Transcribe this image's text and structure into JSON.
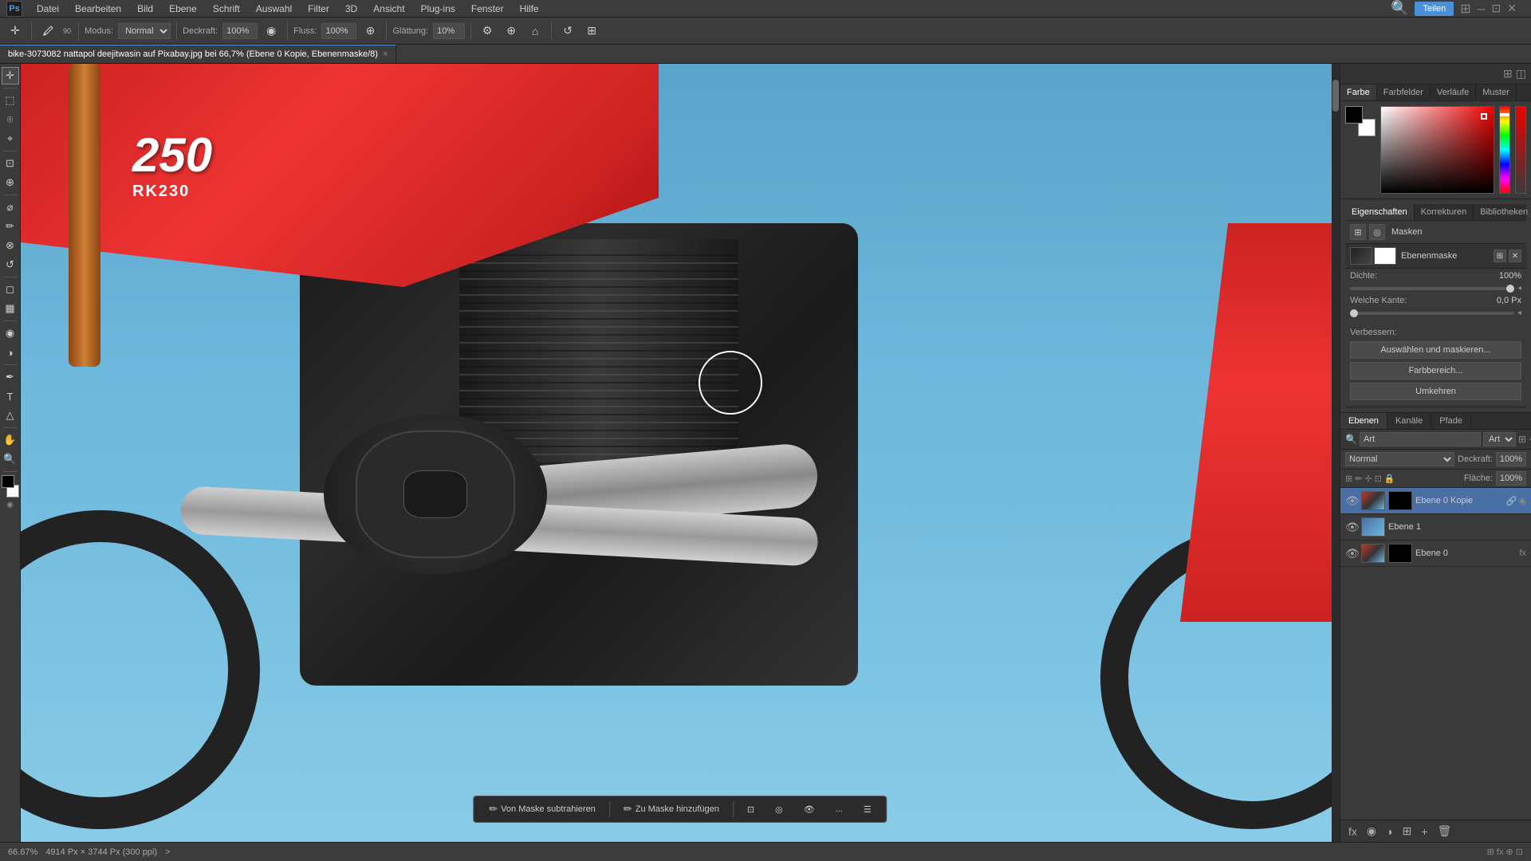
{
  "menubar": {
    "items": [
      "Datei",
      "Bearbeiten",
      "Bild",
      "Ebene",
      "Schrift",
      "Auswahl",
      "Filter",
      "3D",
      "Ansicht",
      "Plug-ins",
      "Fenster",
      "Hilfe"
    ]
  },
  "toolbar": {
    "mode_label": "Modus:",
    "mode_value": "Normal",
    "deckraft_label": "Deckraft:",
    "deckraft_value": "100%",
    "fluss_label": "Fluss:",
    "fluss_value": "100%",
    "glattung_label": "Glättung:",
    "glattung_value": "10%",
    "brush_size": "90",
    "teilen_label": "Teilen"
  },
  "tab": {
    "title": "bike-3073082 nattapol deejitwasin auf Pixabay.jpg bei 66,7% (Ebene 0 Kopie, Ebenenmaske/8)",
    "close": "×"
  },
  "statusbar": {
    "zoom": "66.67%",
    "dimensions": "4914 Px × 3744 Px (300 ppi)",
    "navigation": ">"
  },
  "color_panel": {
    "tabs": [
      "Farbe",
      "Farbfelder",
      "Verläufe",
      "Muster"
    ],
    "active_tab": "Farbe"
  },
  "properties_panel": {
    "tabs": [
      "Eigenschaften",
      "Korrekturen",
      "Bibliotheken"
    ],
    "active_tab": "Eigenschaften",
    "sub_tabs": [
      "Masken"
    ],
    "section_title": "Ebenenmaske",
    "dichte_label": "Dichte:",
    "dichte_value": "100%",
    "weiche_kante_label": "Weiche Kante:",
    "weiche_kante_value": "0,0 Px",
    "verbessern_label": "Verbessern:",
    "auswaehlen_btn": "Auswählen und maskieren...",
    "farbbereich_btn": "Farbbereich...",
    "umkehren_btn": "Umkehren"
  },
  "layers_panel": {
    "tabs": [
      "Ebenen",
      "Kanäle",
      "Pfade"
    ],
    "active_tab": "Ebenen",
    "search_placeholder": "Art",
    "mode": "Normal",
    "deckraft_label": "Deckraft:",
    "deckraft_value": "100%",
    "fixieren_label": "Fixieren:",
    "flaeche_label": "Fläche:",
    "flaeche_value": "100%",
    "layers": [
      {
        "name": "Ebene 0 Kopie",
        "visible": true,
        "active": true,
        "has_mask": true,
        "mask_type": "ebenenmaske"
      },
      {
        "name": "Ebene 1",
        "visible": true,
        "active": false,
        "has_mask": false,
        "thumb_type": "blue"
      },
      {
        "name": "Ebene 0",
        "visible": true,
        "active": false,
        "has_mask": true,
        "mask_type": "ebenenmaske"
      }
    ]
  },
  "bottom_toolbar": {
    "subtract_label": "Von Maske subtrahieren",
    "add_label": "Zu Maske hinzufügen",
    "more_label": "..."
  },
  "icons": {
    "move": "✛",
    "marquee": "⬚",
    "lasso": "⌾",
    "wand": "⌖",
    "crop": "⊡",
    "eyedropper": "⊕",
    "heal": "⌀",
    "brush": "✏",
    "clone": "⊗",
    "history": "↺",
    "eraser": "◻",
    "gradient": "▦",
    "blur": "◉",
    "dodge": "◑",
    "pen": "✒",
    "text": "T",
    "shape": "◻",
    "hand": "✋",
    "zoom": "🔍"
  }
}
